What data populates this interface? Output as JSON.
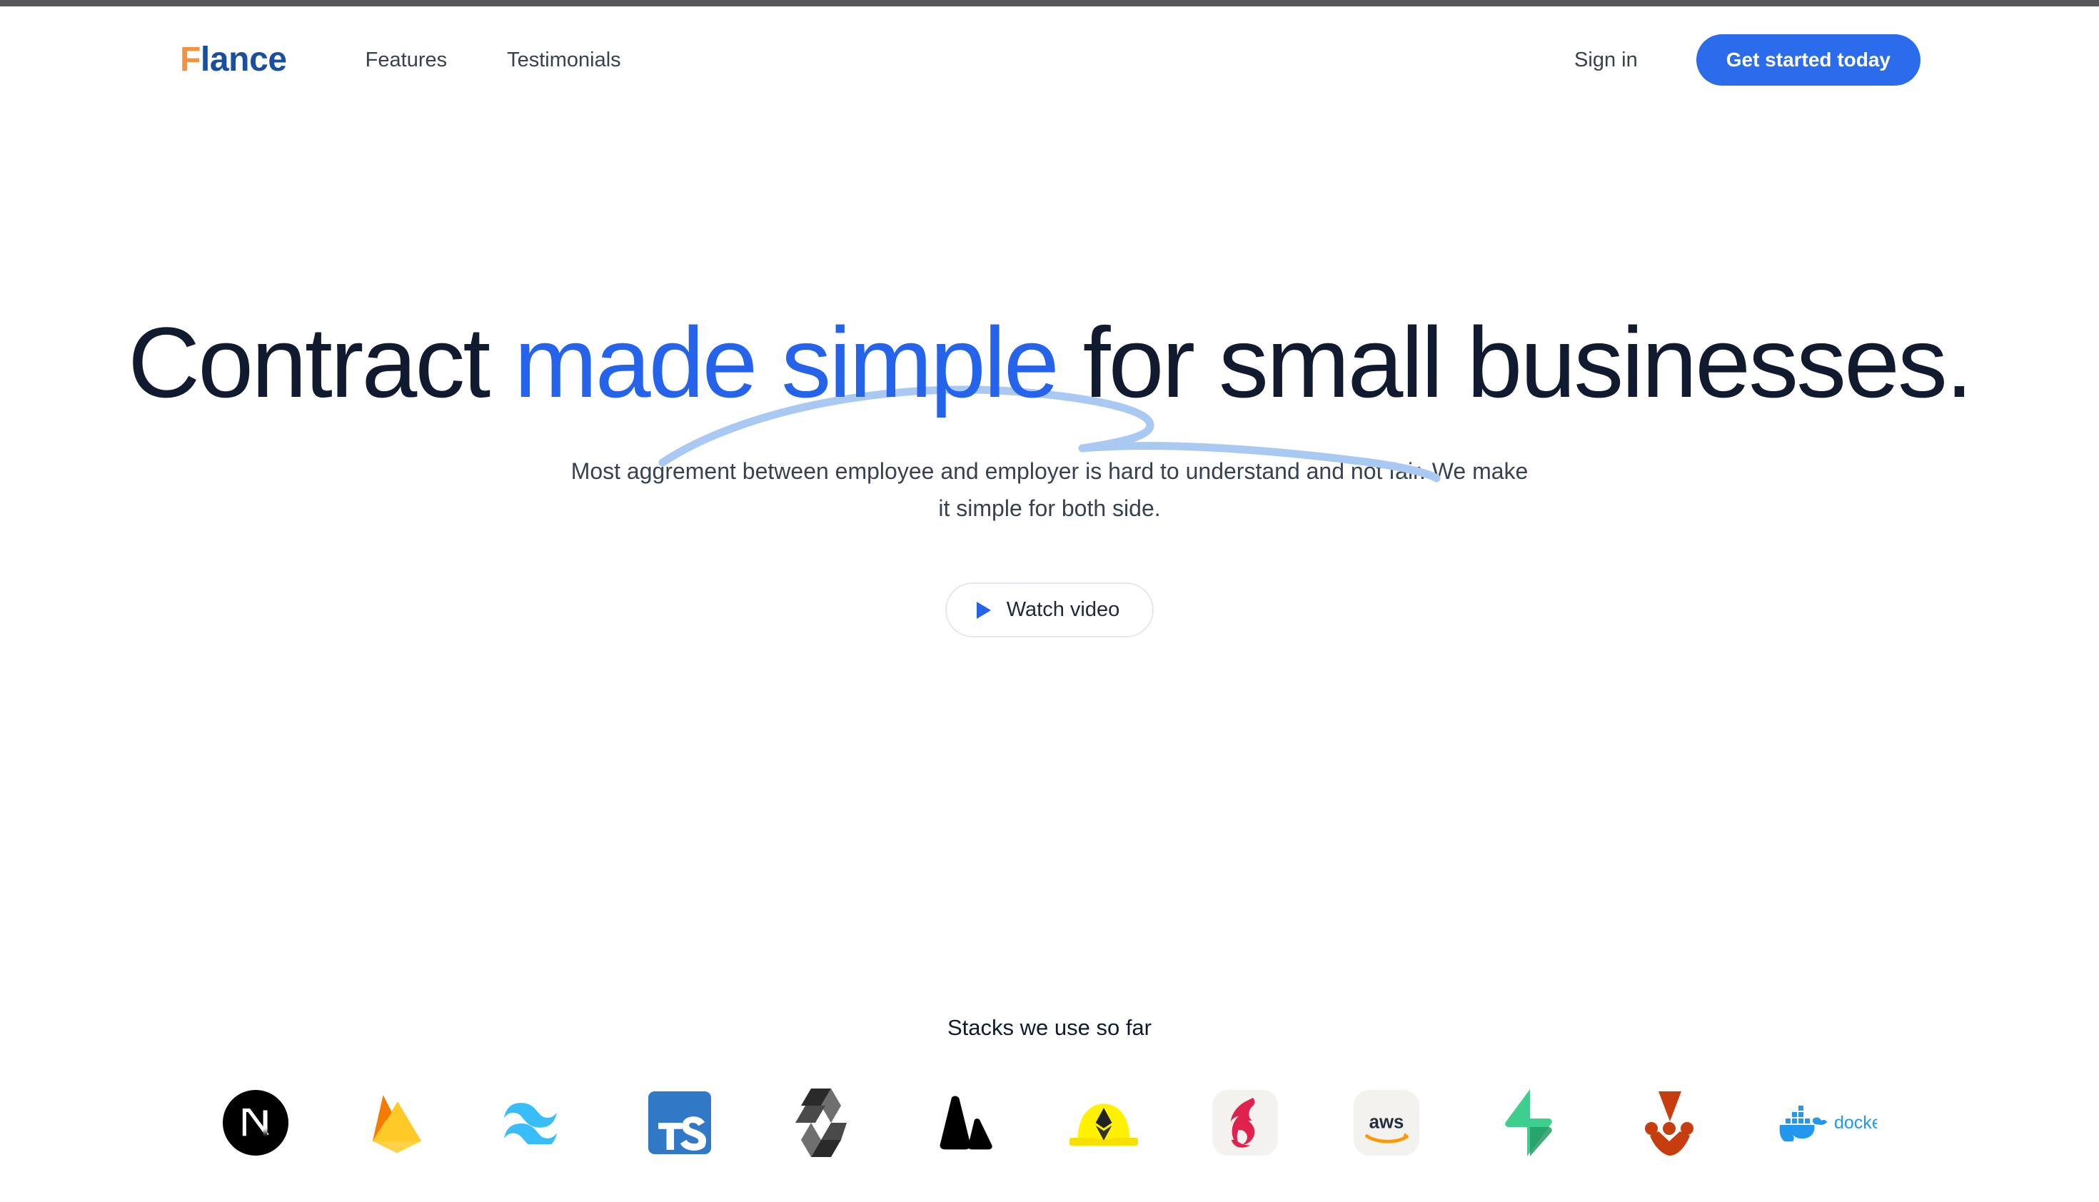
{
  "header": {
    "brand": {
      "prefix": "F",
      "rest": "lance",
      "prefix_color": "#f49244",
      "rest_color": "#1a4fa0"
    },
    "nav": [
      {
        "label": "Features",
        "name": "nav-link-features"
      },
      {
        "label": "Testimonials",
        "name": "nav-link-testimonials"
      }
    ],
    "signin_label": "Sign in",
    "cta_label": "Get started today",
    "cta_color": "#2b6ced"
  },
  "hero": {
    "headline_part1": "Contract ",
    "headline_accent": "made simple",
    "headline_part2": " for small businesses.",
    "headline_color": "#111a2e",
    "headline_accent_color": "#2563eb",
    "swoosh_color": "#a9c9f2",
    "subhead": "Most aggrement between employee and employer is hard to understand and not fair. We make it simple for both side.",
    "watch_video_label": "Watch video",
    "play_icon_color": "#2563eb"
  },
  "stacks": {
    "title": "Stacks we use so far",
    "logos": [
      {
        "name": "nextjs-logo",
        "label": "Next.js"
      },
      {
        "name": "firebase-logo",
        "label": "Firebase"
      },
      {
        "name": "tailwindcss-logo",
        "label": "Tailwind CSS"
      },
      {
        "name": "typescript-logo",
        "label": "TypeScript"
      },
      {
        "name": "solidity-logo",
        "label": "Solidity"
      },
      {
        "name": "alchemy-logo",
        "label": "Alchemy"
      },
      {
        "name": "hardhat-logo",
        "label": "Hardhat"
      },
      {
        "name": "nestjs-logo",
        "label": "NestJS"
      },
      {
        "name": "aws-logo",
        "label": "aws"
      },
      {
        "name": "supabase-logo",
        "label": "Supabase"
      },
      {
        "name": "jest-logo",
        "label": "Jest"
      },
      {
        "name": "docker-logo",
        "label": "docker"
      }
    ]
  }
}
